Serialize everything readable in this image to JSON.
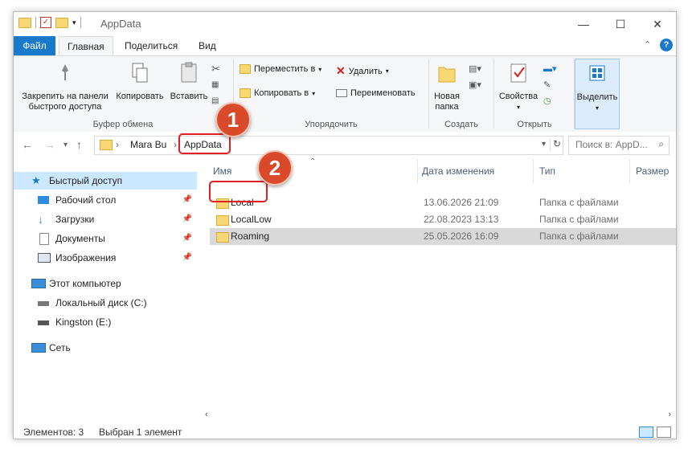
{
  "window": {
    "title": "AppData",
    "minimize": "—",
    "maximize": "☐",
    "close": "✕"
  },
  "ribbon_tabs": [
    "Файл",
    "Главная",
    "Поделиться",
    "Вид"
  ],
  "ribbon": {
    "clipboard": {
      "pin_label_1": "Закрепить на панели",
      "pin_label_2": "быстрого доступа",
      "copy": "Копировать",
      "paste": "Вставить",
      "group": "Буфер обмена"
    },
    "organize": {
      "move": "Переместить в",
      "copy_to": "Копировать в",
      "delete": "Удалить",
      "rename": "Переименовать",
      "group": "Упорядочить"
    },
    "create": {
      "new_folder_1": "Новая",
      "new_folder_2": "папка",
      "group": "Создать"
    },
    "open": {
      "properties": "Свойства",
      "group": "Открыть"
    },
    "select": {
      "select": "Выделить"
    }
  },
  "address": {
    "crumbs": [
      "Mara Bu",
      "AppData"
    ],
    "search_placeholder": "Поиск в: AppD..."
  },
  "nav": {
    "quick_access": "Быстрый доступ",
    "items": [
      "Рабочий стол",
      "Загрузки",
      "Документы",
      "Изображения"
    ],
    "this_pc": "Этот компьютер",
    "drives": [
      "Локальный диск (C:)",
      "Kingston (E:)"
    ],
    "network": "Сеть"
  },
  "columns": [
    "Имя",
    "Дата изменения",
    "Тип",
    "Размер"
  ],
  "files": [
    {
      "name": "Local",
      "date": "13.06.2026 21:09",
      "type": "Папка с файлами"
    },
    {
      "name": "LocalLow",
      "date": "22.08.2023 13:13",
      "type": "Папка с файлами"
    },
    {
      "name": "Roaming",
      "date": "25.05.2026 16:09",
      "type": "Папка с файлами"
    }
  ],
  "status": {
    "count": "Элементов: 3",
    "selected": "Выбран 1 элемент"
  },
  "badges": [
    "1",
    "2"
  ],
  "colors": {
    "accent": "#1979ca",
    "badge": "#d94a2b",
    "highlight": "#e02020",
    "selection": "#cce8ff"
  }
}
